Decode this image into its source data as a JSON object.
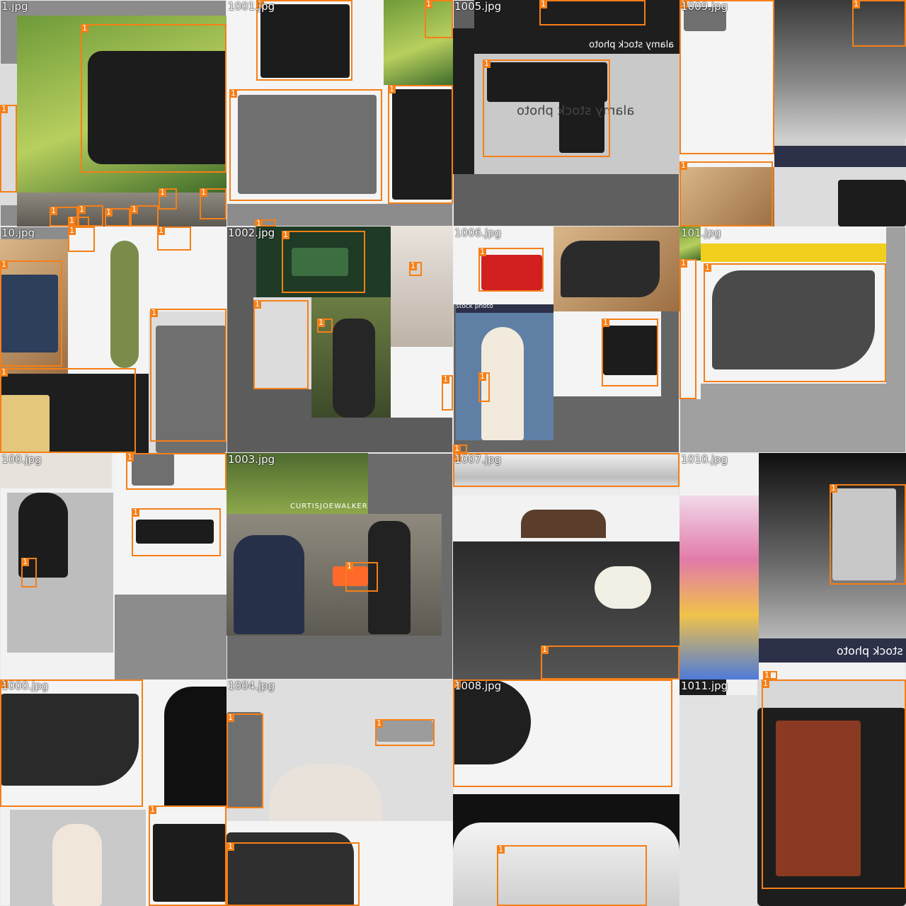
{
  "tiles": [
    {
      "label": "1.jpg",
      "boxes": [
        "1",
        "1",
        "1",
        "1",
        "1",
        "1",
        "1",
        "1",
        "1"
      ]
    },
    {
      "label": "1001.jpg",
      "boxes": [
        "1",
        "1",
        "1",
        "1",
        "1"
      ]
    },
    {
      "label": "1005.jpg",
      "boxes": [
        "1",
        "1"
      ],
      "watermark": "alamy stock photo"
    },
    {
      "label": "1009.jpg",
      "boxes": [
        "1",
        "1",
        "1"
      ]
    },
    {
      "label": "10.jpg",
      "boxes": [
        "1",
        "1",
        "1",
        "1",
        "1"
      ]
    },
    {
      "label": "1002.jpg",
      "boxes": [
        "1",
        "1",
        "1",
        "1",
        "1"
      ]
    },
    {
      "label": "1006.jpg",
      "boxes": [
        "1",
        "1",
        "1",
        "1"
      ],
      "watermark": "stock photo"
    },
    {
      "label": "101.jpg",
      "boxes": [
        "1",
        "1"
      ]
    },
    {
      "label": "100.jpg",
      "boxes": [
        "1",
        "1",
        "1"
      ]
    },
    {
      "label": "1003.jpg",
      "boxes": [
        "1"
      ],
      "watermark": "CURTISJOEWALKER.COM"
    },
    {
      "label": "1007.jpg",
      "boxes": [
        "1",
        "1"
      ]
    },
    {
      "label": "1010.jpg",
      "boxes": [
        "1",
        "1"
      ],
      "watermark": "stock photo"
    },
    {
      "label": "1000.jpg",
      "boxes": [
        "1",
        "1"
      ]
    },
    {
      "label": "1004.jpg",
      "boxes": [
        "1",
        "1",
        "1"
      ]
    },
    {
      "label": "1008.jpg",
      "boxes": [
        "1",
        "1"
      ]
    },
    {
      "label": "1011.jpg",
      "boxes": [
        "1"
      ]
    }
  ]
}
